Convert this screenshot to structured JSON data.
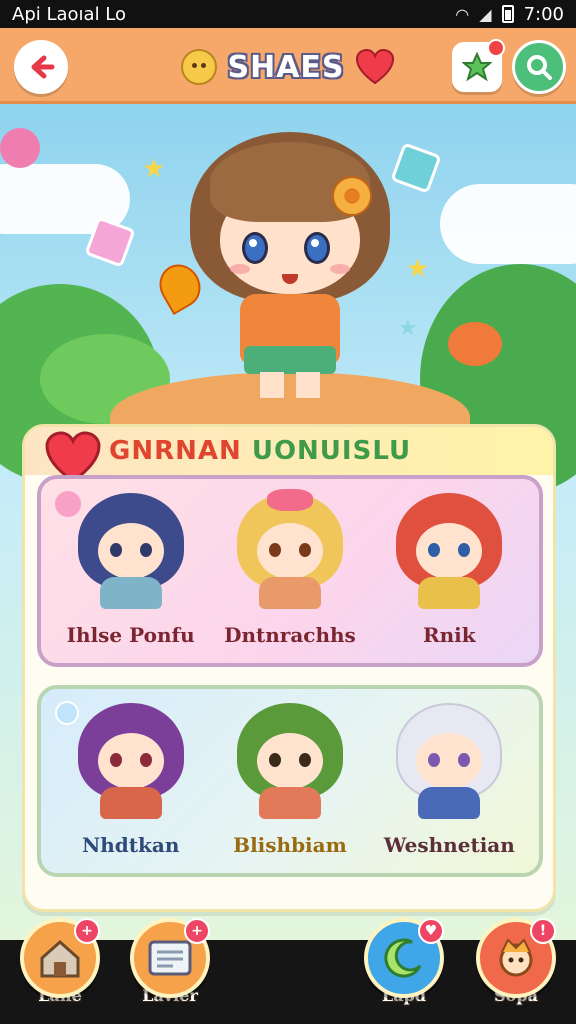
{
  "status_bar": {
    "carrier": "Api Laoıal Lo",
    "time": "7:00"
  },
  "header": {
    "title": "SHAES",
    "back_icon": "arrow-left-icon",
    "star_icon": "star-icon",
    "search_icon": "search-icon"
  },
  "panel": {
    "title_part1": "GNRNAN",
    "title_part2": "UONUISLU",
    "group_top": [
      {
        "name": "Ihlse Ponfu",
        "hair": "#3d4a8c",
        "outfit": "#7fb3c8"
      },
      {
        "name": "Dntnrachhs",
        "hair": "#f0c65a",
        "outfit": "#e89a6a"
      },
      {
        "name": "Rnik",
        "hair": "#e0503e",
        "outfit": "#e9c04a"
      }
    ],
    "group_bottom": [
      {
        "name": "Nhdtkan",
        "hair": "#7b3f9a",
        "outfit": "#d8664a"
      },
      {
        "name": "Blishbiam",
        "hair": "#5b9a3a",
        "outfit": "#e27a5a"
      },
      {
        "name": "Weshnetian",
        "hair": "#e8e8f2",
        "outfit": "#4a6ab8"
      }
    ]
  },
  "bottom_nav": [
    {
      "label": "Lane",
      "icon": "house-icon",
      "color": "#f6a24a",
      "badge": "+"
    },
    {
      "label": "Lavıer",
      "icon": "card-icon",
      "color": "#f6a24a",
      "badge": "+"
    },
    {
      "label": "Lapd",
      "icon": "moon-icon",
      "color": "#3fa6e8",
      "badge": "♥"
    },
    {
      "label": "Sopa",
      "icon": "mascot-icon",
      "color": "#f0694a",
      "badge": "!"
    }
  ],
  "colors": {
    "header": "#f6a86a",
    "accent_red": "#e0452f",
    "accent_green": "#3f9a4a"
  }
}
